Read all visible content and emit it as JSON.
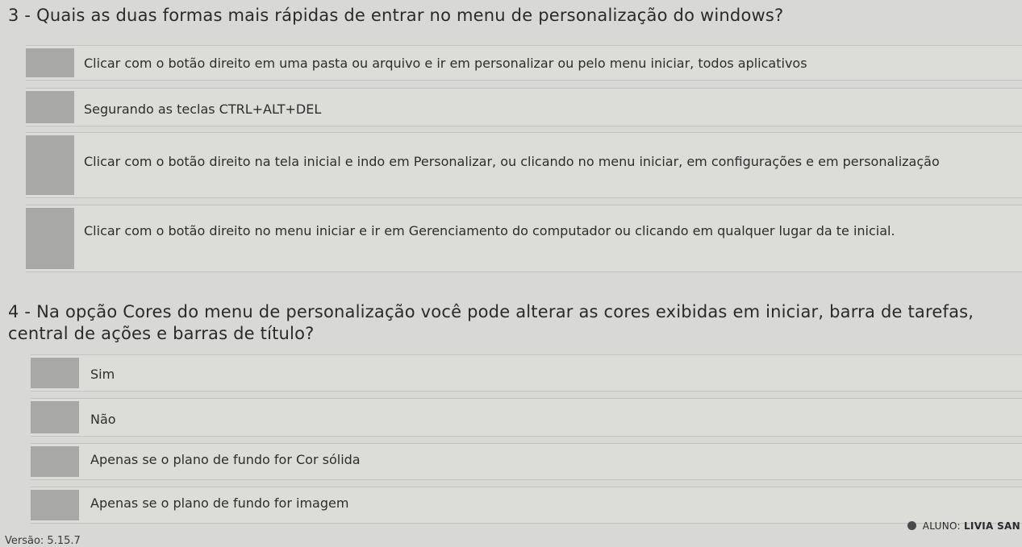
{
  "q3": {
    "title": "3 - Quais as duas formas mais rápidas de entrar no menu de personalização do windows?",
    "options": [
      "Clicar com o botão direito em uma pasta ou arquivo e ir em personalizar ou pelo menu iniciar, todos aplicativos",
      "Segurando as teclas CTRL+ALT+DEL",
      "Clicar com o botão direito na tela inicial e indo em Personalizar, ou clicando no menu iniciar, em configurações e em personalização",
      "Clicar com o botão direito no menu iniciar e ir em Gerenciamento do computador ou clicando em qualquer lugar da te inicial."
    ]
  },
  "q4": {
    "title": "4 - Na opção Cores do menu de personalização você pode alterar as cores exibidas em iniciar, barra de tarefas, central de ações e barras de título?",
    "options": [
      "Sim",
      "Não",
      "Apenas se o plano de fundo for Cor sólida",
      "Apenas se o plano de fundo for imagem"
    ]
  },
  "footer": {
    "version": "Versão: 5.15.7",
    "user_label": "ALUNO:",
    "user_name": "LIVIA SAN",
    "user_icon": "user-icon"
  }
}
